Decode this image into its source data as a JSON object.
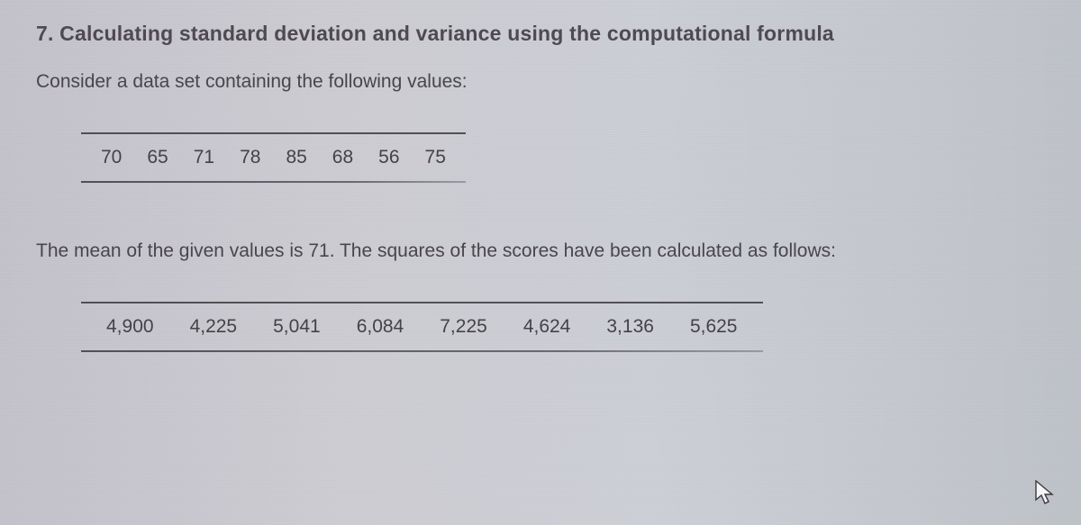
{
  "title": "7. Calculating standard deviation and variance using the computational formula",
  "intro": "Consider a data set containing the following values:",
  "values": [
    "70",
    "65",
    "71",
    "78",
    "85",
    "68",
    "56",
    "75"
  ],
  "mean_line": "The mean of the given values is 71. The squares of the scores have been calculated as follows:",
  "squares": [
    "4,900",
    "4,225",
    "5,041",
    "6,084",
    "7,225",
    "4,624",
    "3,136",
    "5,625"
  ]
}
